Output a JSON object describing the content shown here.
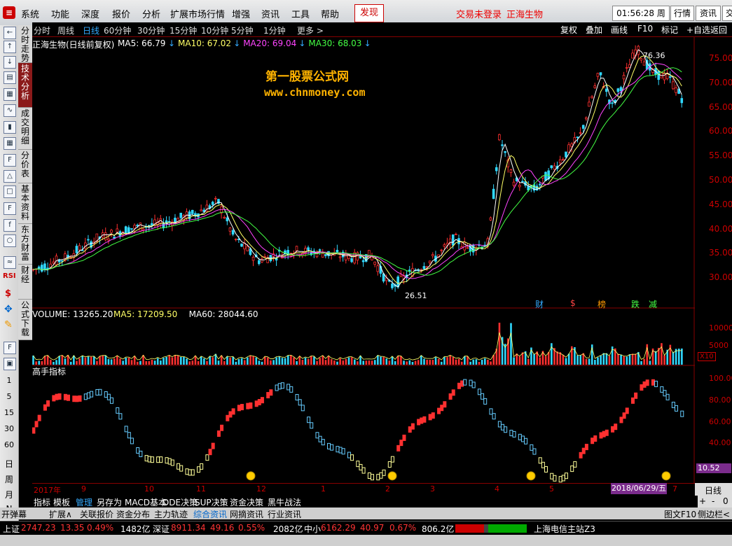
{
  "menu": {
    "logo": "≡",
    "items": [
      "系统",
      "功能",
      "深度",
      "报价",
      "分析",
      "扩展市场行情",
      "增强",
      "资讯",
      "工具",
      "帮助"
    ],
    "discover": "发现",
    "not_logged": "交易未登录",
    "stock_name_top": "正海生物",
    "clock": "01:56:28 周六",
    "right_buttons": [
      "行情",
      "资讯",
      "交"
    ]
  },
  "left_numbers": [
    "1",
    "5",
    "15",
    "30",
    "60"
  ],
  "left_period_letters": [
    "日",
    "周",
    "月",
    "N"
  ],
  "vertical_tabs": [
    "分时走势",
    "技术分析",
    "成交明细",
    "分价表",
    "基本资料",
    "东方财富",
    "财经",
    "公式下载"
  ],
  "period_bar": {
    "periods": [
      "分时",
      "周线",
      "日线",
      "60分钟",
      "30分钟",
      "15分钟",
      "10分钟",
      "5分钟",
      "1分钟",
      "更多 >"
    ],
    "active": "日线",
    "right_buttons": [
      "复权",
      "叠加",
      "画线",
      "F10",
      "标记",
      "+自选",
      "返回"
    ]
  },
  "main_chart": {
    "title": "正海生物(日线前复权)",
    "ma": [
      {
        "label": "MA5: 66.79",
        "color": "#ffffff"
      },
      {
        "label": "MA10: 67.02",
        "color": "#ffff66"
      },
      {
        "label": "MA20: 69.04",
        "color": "#ff44ff"
      },
      {
        "label": "MA30: 68.03",
        "color": "#44ff44"
      }
    ],
    "watermark_title": "第一股票公式网",
    "watermark_url": "www.chnmoney.com",
    "high_label": "76.36",
    "low_label": "26.51",
    "y_ticks": [
      "75.00",
      "70.00",
      "65.00",
      "60.00",
      "55.00",
      "50.00",
      "45.00",
      "40.00",
      "35.00",
      "30.00"
    ],
    "event_marks": [
      {
        "text": "财",
        "color": "#3af"
      },
      {
        "text": "$",
        "color": "#f44"
      },
      {
        "text": "榜",
        "color": "#f90"
      },
      {
        "text": "跌",
        "color": "#4f4"
      },
      {
        "text": "减",
        "color": "#4f4"
      }
    ]
  },
  "volume_chart": {
    "title": "VOLUME: 13265.20",
    "ma": [
      {
        "label": "MA5: 17209.50",
        "color": "#ffff66"
      },
      {
        "label": "MA60: 28044.60",
        "color": "#ffffff"
      }
    ],
    "y_ticks": [
      "10000",
      "5000"
    ],
    "unit": "X10"
  },
  "indicator": {
    "title": "高手指标",
    "y_ticks": [
      "100.00",
      "80.00",
      "60.00",
      "40.00"
    ],
    "current_value": "10.52"
  },
  "x_axis": {
    "labels": [
      "2017年",
      "9",
      "10",
      "11",
      "12",
      "1",
      "2",
      "3",
      "4",
      "5",
      "7"
    ],
    "date_box": "2018/06/29/五",
    "period_label": "日线",
    "zoom": [
      "+",
      "-",
      "0"
    ]
  },
  "tabs_row1": {
    "items": [
      "指标",
      "模板",
      "管理",
      "另存为",
      "MACD基本",
      "DDE决策",
      "SUP决策",
      "资金决策",
      "黑牛战法"
    ],
    "active": "管理"
  },
  "tabs_row2": {
    "items": [
      "开弹幕",
      "扩展∧",
      "关联报价",
      "资金分布",
      "主力轨迹",
      "综合资讯",
      "网摘资讯",
      "行业资讯"
    ],
    "active": "综合资讯",
    "right": [
      "图文F10",
      "侧边栏<"
    ]
  },
  "status": {
    "sh_label": "上证",
    "sh_value": "2747.23",
    "sh_change": "13.35",
    "sh_pct": "0.49%",
    "sh_amount": "1482亿",
    "sz_label": "深证",
    "sz_value": "8911.34",
    "sz_change": "49.16",
    "sz_pct": "0.55%",
    "sz_amount": "2082亿",
    "zx_label": "中小",
    "zx_value": "6162.29",
    "zx_change": "40.97",
    "zx_pct": "0.67%",
    "zx_amount": "806.2亿",
    "server": "上海电信主站Z3"
  }
}
